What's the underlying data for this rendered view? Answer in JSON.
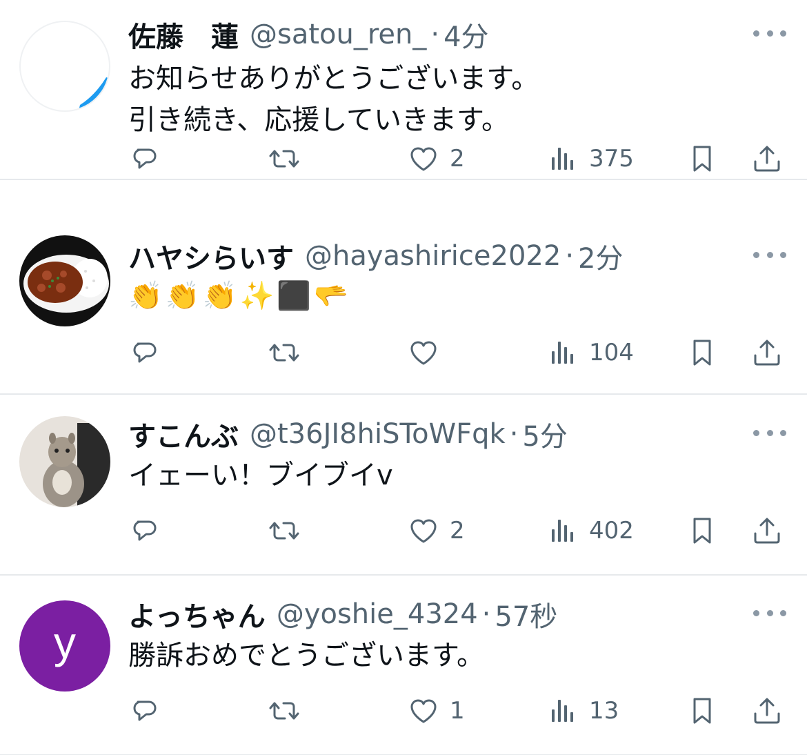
{
  "tweets": [
    {
      "name": "佐藤　蓮",
      "handle": "@satou_ren_",
      "time": "4分",
      "lines": [
        "お知らせありがとうございます。",
        "引き続き、応援していきます。"
      ],
      "replies": "",
      "retweets": "",
      "likes": "2",
      "views": "375",
      "avatar_icon": "white-avatar-with-blue-stroke"
    },
    {
      "name": "ハヤシらいす",
      "handle": "@hayashirice2022",
      "time": "2分",
      "lines": [],
      "emojis": [
        "👏",
        "👏",
        "👏",
        "✨",
        "⬛",
        "🫳"
      ],
      "replies": "",
      "retweets": "",
      "likes": "",
      "views": "104",
      "avatar_icon": "hayashi-rice-plate-avatar"
    },
    {
      "name": "すこんぶ",
      "handle": "@t36JI8hiSToWFqk",
      "time": "5分",
      "lines": [
        "イェーい！ブイブイv"
      ],
      "replies": "",
      "retweets": "",
      "likes": "2",
      "views": "402",
      "avatar_icon": "squirrel-photo-avatar"
    },
    {
      "name": "よっちゃん",
      "handle": "@yoshie_4324",
      "time": "57秒",
      "lines": [
        "勝訴おめでとうございます。"
      ],
      "replies": "",
      "retweets": "",
      "likes": "1",
      "views": "13",
      "avatar_letter": "y",
      "avatar_color": "#7b1fa2"
    }
  ],
  "dot": "·",
  "icons": [
    "reply-icon",
    "retweet-icon",
    "like-icon",
    "views-icon",
    "bookmark-icon",
    "share-icon",
    "more-icon"
  ],
  "colors": {
    "text": "#0f1419",
    "secondary": "#536471",
    "divider": "#e6e9ec"
  }
}
